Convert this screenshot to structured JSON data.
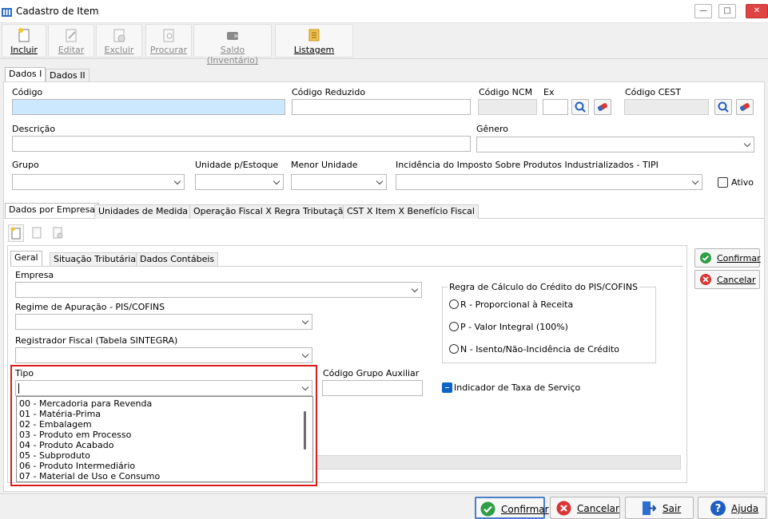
{
  "window": {
    "title": "Cadastro de Item"
  },
  "toolbar": {
    "incluir": "Incluir",
    "editar": "Editar",
    "excluir": "Excluir",
    "procurar": "Procurar",
    "saldo": "Saldo (Inventário)",
    "listagem": "Listagem"
  },
  "tabs_top": [
    "Dados I",
    "Dados II"
  ],
  "form": {
    "codigo": "Código",
    "codigo_reduzido": "Código Reduzido",
    "codigo_ncm": "Código NCM",
    "ex": "Ex",
    "codigo_cest": "Código CEST",
    "descricao": "Descrição",
    "genero": "Gênero",
    "grupo": "Grupo",
    "unidade_estoque": "Unidade p/Estoque",
    "menor_unidade": "Menor Unidade",
    "tipi": "Incidência do Imposto Sobre Produtos Industrializados - TIPI",
    "ativo": "Ativo"
  },
  "tabs_mid": [
    "Dados por Empresa",
    "Unidades de Medida",
    "Operação Fiscal X Regra Tributação",
    "CST X Item X Benefício Fiscal"
  ],
  "tabs_inner": [
    "Geral",
    "Situação Tributária",
    "Dados Contábeis"
  ],
  "inner": {
    "empresa": "Empresa",
    "regime": "Regime de Apuração - PIS/COFINS",
    "registrador": "Registrador Fiscal (Tabela SINTEGRA)",
    "tipo": "Tipo",
    "codigo_grupo": "Código Grupo Auxiliar",
    "regra_titulo": "Regra de Cálculo do Crédito do PIS/COFINS",
    "regra_r": "R - Proporcional à Receita",
    "regra_p": "P - Valor Integral (100%)",
    "regra_n": "N - Isento/Não-Incidência de Crédito",
    "indicador": "Indicador de Taxa de Serviço"
  },
  "tipo_options": [
    "00 - Mercadoria para Revenda",
    "01 - Matéria-Prima",
    "02 - Embalagem",
    "03 - Produto em Processo",
    "04 - Produto Acabado",
    "05 - Subproduto",
    "06 - Produto Intermediário",
    "07 - Material de Uso e Consumo"
  ],
  "side": {
    "confirmar": "Confirmar",
    "cancelar": "Cancelar"
  },
  "bottom": {
    "confirmar": "Confirmar",
    "cancelar": "Cancelar",
    "sair": "Sair",
    "ajuda": "Ajuda"
  },
  "colors": {
    "selected_field": "#cce8ff",
    "highlight_border": "#d91c1c",
    "confirm_green": "#2f9e44",
    "cancel_red": "#d93636",
    "help_blue": "#1f5fbf"
  }
}
